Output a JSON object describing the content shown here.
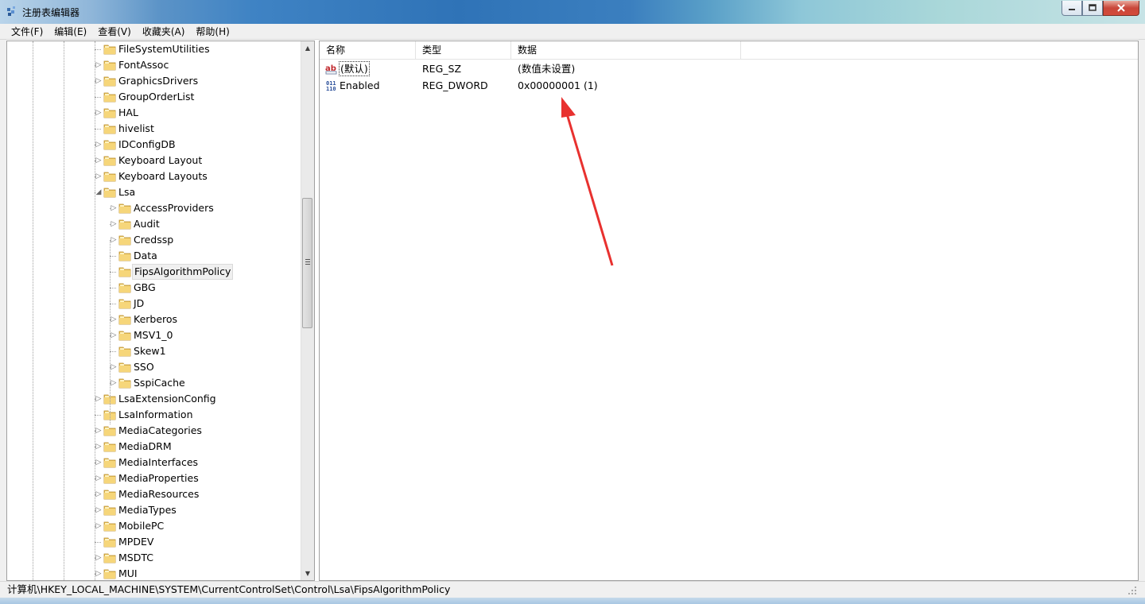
{
  "window": {
    "title": "注册表编辑器",
    "controls": {
      "minimize": "minimize",
      "maximize": "maximize",
      "close": "close"
    }
  },
  "menu": [
    "文件(F)",
    "编辑(E)",
    "查看(V)",
    "收藏夹(A)",
    "帮助(H)"
  ],
  "tree": {
    "items": [
      {
        "label": "FileSystemUtilities",
        "level": 0,
        "expander": "none"
      },
      {
        "label": "FontAssoc",
        "level": 0,
        "expander": "collapsed"
      },
      {
        "label": "GraphicsDrivers",
        "level": 0,
        "expander": "collapsed"
      },
      {
        "label": "GroupOrderList",
        "level": 0,
        "expander": "none"
      },
      {
        "label": "HAL",
        "level": 0,
        "expander": "collapsed"
      },
      {
        "label": "hivelist",
        "level": 0,
        "expander": "none"
      },
      {
        "label": "IDConfigDB",
        "level": 0,
        "expander": "collapsed"
      },
      {
        "label": "Keyboard Layout",
        "level": 0,
        "expander": "collapsed"
      },
      {
        "label": "Keyboard Layouts",
        "level": 0,
        "expander": "collapsed"
      },
      {
        "label": "Lsa",
        "level": 0,
        "expander": "expanded"
      },
      {
        "label": "AccessProviders",
        "level": 1,
        "expander": "collapsed"
      },
      {
        "label": "Audit",
        "level": 1,
        "expander": "collapsed"
      },
      {
        "label": "Credssp",
        "level": 1,
        "expander": "collapsed"
      },
      {
        "label": "Data",
        "level": 1,
        "expander": "none"
      },
      {
        "label": "FipsAlgorithmPolicy",
        "level": 1,
        "expander": "none",
        "selected": true
      },
      {
        "label": "GBG",
        "level": 1,
        "expander": "none"
      },
      {
        "label": "JD",
        "level": 1,
        "expander": "none"
      },
      {
        "label": "Kerberos",
        "level": 1,
        "expander": "collapsed"
      },
      {
        "label": "MSV1_0",
        "level": 1,
        "expander": "collapsed"
      },
      {
        "label": "Skew1",
        "level": 1,
        "expander": "none"
      },
      {
        "label": "SSO",
        "level": 1,
        "expander": "collapsed"
      },
      {
        "label": "SspiCache",
        "level": 1,
        "expander": "collapsed"
      },
      {
        "label": "LsaExtensionConfig",
        "level": 0,
        "expander": "collapsed"
      },
      {
        "label": "LsaInformation",
        "level": 0,
        "expander": "none"
      },
      {
        "label": "MediaCategories",
        "level": 0,
        "expander": "collapsed"
      },
      {
        "label": "MediaDRM",
        "level": 0,
        "expander": "collapsed"
      },
      {
        "label": "MediaInterfaces",
        "level": 0,
        "expander": "collapsed"
      },
      {
        "label": "MediaProperties",
        "level": 0,
        "expander": "collapsed"
      },
      {
        "label": "MediaResources",
        "level": 0,
        "expander": "collapsed"
      },
      {
        "label": "MediaTypes",
        "level": 0,
        "expander": "collapsed"
      },
      {
        "label": "MobilePC",
        "level": 0,
        "expander": "collapsed"
      },
      {
        "label": "MPDEV",
        "level": 0,
        "expander": "none"
      },
      {
        "label": "MSDTC",
        "level": 0,
        "expander": "collapsed"
      },
      {
        "label": "MUI",
        "level": 0,
        "expander": "collapsed"
      }
    ]
  },
  "list": {
    "columns": [
      "名称",
      "类型",
      "数据"
    ],
    "rows": [
      {
        "name": "(默认)",
        "type": "REG_SZ",
        "data": "(数值未设置)",
        "icon": "string-value-icon"
      },
      {
        "name": "Enabled",
        "type": "REG_DWORD",
        "data": "0x00000001 (1)",
        "icon": "binary-value-icon"
      }
    ]
  },
  "status": {
    "path": "计算机\\HKEY_LOCAL_MACHINE\\SYSTEM\\CurrentControlSet\\Control\\Lsa\\FipsAlgorithmPolicy"
  },
  "annotation": {
    "color": "#e8312f"
  }
}
